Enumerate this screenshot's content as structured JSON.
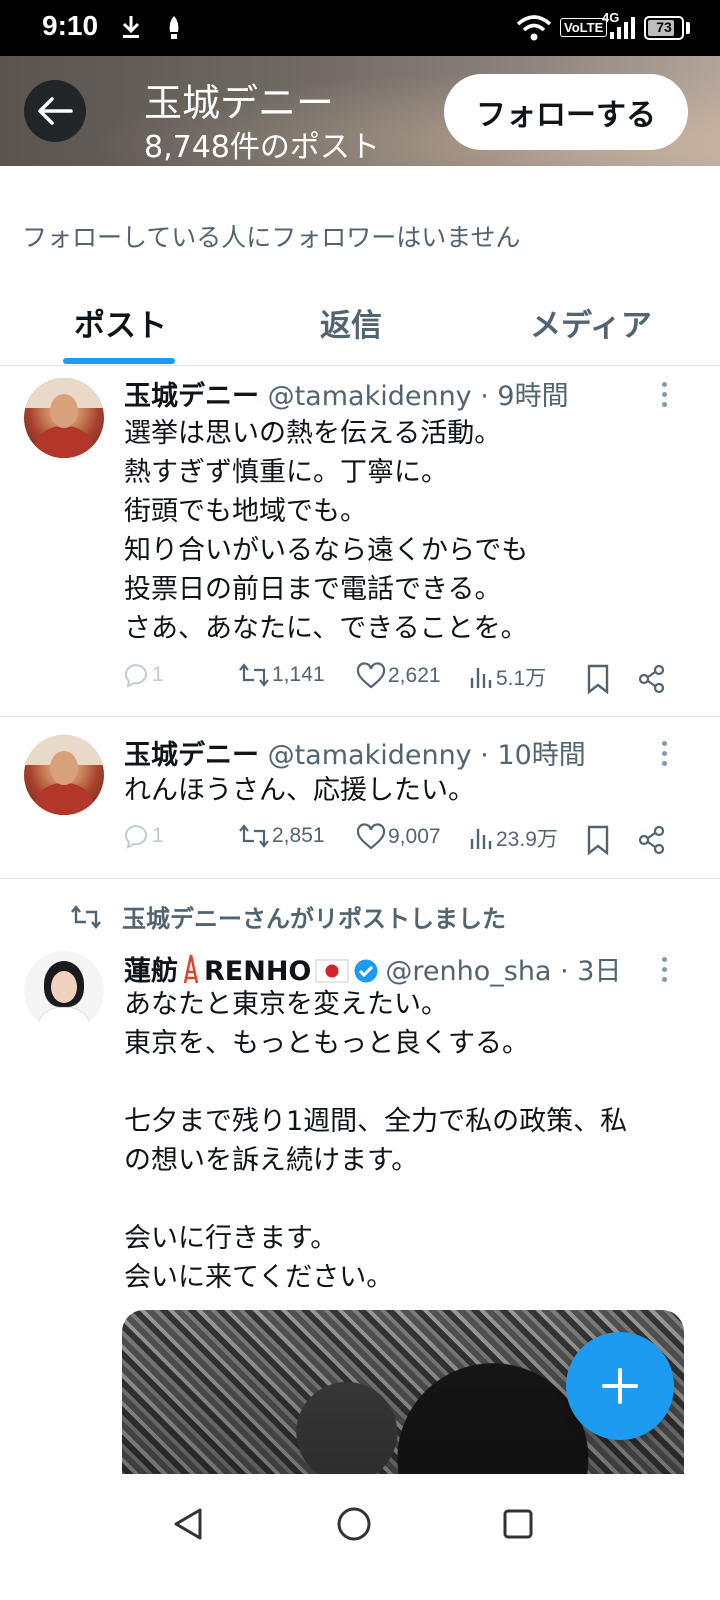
{
  "status_bar": {
    "time": "9:10",
    "network_label": "VoLTE",
    "network_type": "4G",
    "battery_level": "73",
    "icons": [
      "download-icon",
      "notification-icon",
      "wifi-icon",
      "signal-icon",
      "battery-icon"
    ]
  },
  "header": {
    "title": "玉城デニー",
    "post_count": "8,748件のポスト",
    "follow_label": "フォローする"
  },
  "profile": {
    "followers_note": "フォローしている人にフォロワーはいません"
  },
  "tabs": [
    {
      "label": "ポスト",
      "active": true
    },
    {
      "label": "返信",
      "active": false
    },
    {
      "label": "メディア",
      "active": false
    }
  ],
  "tweets": [
    {
      "name": "玉城デニー",
      "handle": "@tamakidenny",
      "time": "· 9時間",
      "text": "選挙は思いの熱を伝える活動。\n熱すぎず慎重に。丁寧に。\n街頭でも地域でも。\n知り合いがいるなら遠くからでも\n投票日の前日まで電話できる。\nさあ、あなたに、できることを。",
      "replies": "1",
      "reposts": "1,141",
      "likes": "2,621",
      "views": "5.1万"
    },
    {
      "name": "玉城デニー",
      "handle": "@tamakidenny",
      "time": "· 10時間",
      "text": "れんほうさん、応援したい。",
      "replies": "1",
      "reposts": "2,851",
      "likes": "9,007",
      "views": "23.9万"
    },
    {
      "repost_note": "玉城デニーさんがリポストしました",
      "name": "蓮舫",
      "name_suffix": "RENHO",
      "handle": "@renho_sha",
      "time": "· 3日",
      "text": "あなたと東京を変えたい。\n東京を、もっともっと良くする。\n\n七夕まで残り1週間、全力で私の政策、私\nの想いを訴え続けます。\n\n会いに行きます。\n会いに来てください。"
    }
  ],
  "colors": {
    "accent": "#1d9bf0",
    "text_primary": "#0f1419",
    "text_secondary": "#536471"
  }
}
